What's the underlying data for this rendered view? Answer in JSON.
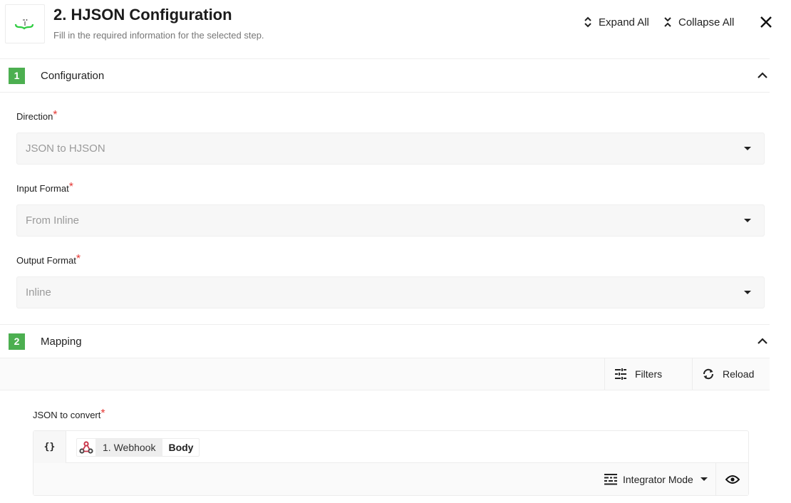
{
  "header": {
    "title": "2. HJSON Configuration",
    "subtitle": "Fill in the required information for the selected step.",
    "logo_icon": "hjson-braces-icon",
    "expand_all_label": "Expand All",
    "collapse_all_label": "Collapse All",
    "close_icon": "close-icon"
  },
  "sections": [
    {
      "number": "1",
      "title": "Configuration",
      "expanded": true,
      "fields": [
        {
          "label": "Direction",
          "required": "*",
          "value": "JSON to HJSON"
        },
        {
          "label": "Input Format",
          "required": "*",
          "value": "From Inline"
        },
        {
          "label": "Output Format",
          "required": "*",
          "value": "Inline"
        }
      ]
    },
    {
      "number": "2",
      "title": "Mapping",
      "expanded": true,
      "toolbar": {
        "filters_label": "Filters",
        "reload_label": "Reload"
      },
      "json_field": {
        "label": "JSON to convert",
        "required": "*",
        "braces": "{}",
        "token": {
          "icon": "webhook-icon",
          "source": "1. Webhook",
          "field": "Body"
        },
        "mode_label": "Integrator Mode",
        "preview_icon": "eye-icon"
      }
    }
  ],
  "colors": {
    "accent_green": "#4caf50",
    "required_red": "#e53935",
    "webhook_red": "#c9364b"
  }
}
